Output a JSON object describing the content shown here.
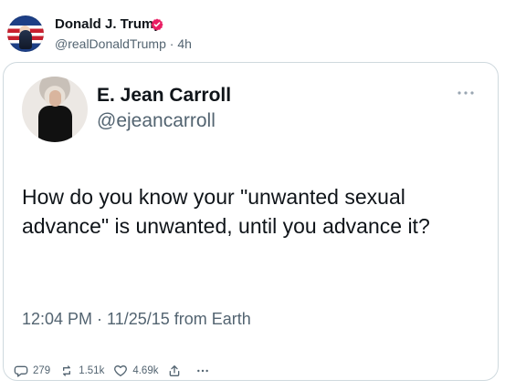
{
  "header": {
    "author_name": "Donald J. Trump",
    "handle": "@realDonaldTrump",
    "age": "4h",
    "separator": "·"
  },
  "quote": {
    "name": "E. Jean Carroll",
    "handle": "@ejeancarroll",
    "text": "How do you know your \"unwanted sexual advance\" is unwanted, until you advance it?",
    "timestamp": "12:04 PM · 11/25/15 from Earth"
  },
  "actions": {
    "replies": "279",
    "reposts": "1.51k",
    "likes": "4.69k"
  },
  "icons": {
    "verified": "verified-badge-icon",
    "more": "more-icon",
    "reply": "reply-icon",
    "repost": "repost-icon",
    "like": "heart-icon",
    "share": "share-icon"
  },
  "colors": {
    "text": "#0f1419",
    "secondary": "#536471",
    "verified": "#e91e63",
    "border": "#cfd9de"
  }
}
